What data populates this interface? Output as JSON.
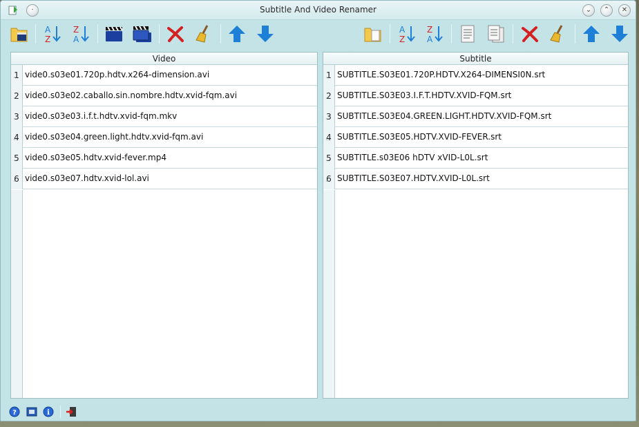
{
  "window": {
    "title": "Subtitle And Video Renamer",
    "buttons": {
      "minimize": "⌄",
      "maximize": "⌃",
      "close": "✕"
    }
  },
  "toolbar_left": [
    {
      "name": "open-videos",
      "icon": "folder-video-icon"
    },
    {
      "name": "sort-asc",
      "icon": "sort-az-icon"
    },
    {
      "name": "sort-desc",
      "icon": "sort-za-icon"
    },
    {
      "name": "video-clapper",
      "icon": "clapper-icon"
    },
    {
      "name": "video-clapper-multi",
      "icon": "clapper-multi-icon"
    },
    {
      "name": "remove",
      "icon": "red-x-icon"
    },
    {
      "name": "clear",
      "icon": "broom-icon"
    },
    {
      "name": "move-up",
      "icon": "arrow-up-icon"
    },
    {
      "name": "move-down",
      "icon": "arrow-down-icon"
    }
  ],
  "toolbar_right": [
    {
      "name": "open-subtitles",
      "icon": "folder-document-icon"
    },
    {
      "name": "sort-asc",
      "icon": "sort-az-icon"
    },
    {
      "name": "sort-desc",
      "icon": "sort-za-icon"
    },
    {
      "name": "document",
      "icon": "document-icon"
    },
    {
      "name": "documents",
      "icon": "documents-icon"
    },
    {
      "name": "remove",
      "icon": "red-x-icon"
    },
    {
      "name": "clear",
      "icon": "broom-icon"
    },
    {
      "name": "move-up",
      "icon": "arrow-up-icon"
    },
    {
      "name": "move-down",
      "icon": "arrow-down-icon"
    }
  ],
  "video_panel": {
    "header": "Video",
    "rows": [
      {
        "num": "1",
        "name": "vide0.s03e01.720p.hdtv.x264-dimension.avi"
      },
      {
        "num": "2",
        "name": "vide0.s03e02.caballo.sin.nombre.hdtv.xvid-fqm.avi"
      },
      {
        "num": "3",
        "name": "vide0.s03e03.i.f.t.hdtv.xvid-fqm.mkv"
      },
      {
        "num": "4",
        "name": "vide0.s03e04.green.light.hdtv.xvid-fqm.avi"
      },
      {
        "num": "5",
        "name": "vide0.s03e05.hdtv.xvid-fever.mp4"
      },
      {
        "num": "6",
        "name": "vide0.s03e07.hdtv.xvid-lol.avi"
      }
    ]
  },
  "subtitle_panel": {
    "header": "Subtitle",
    "rows": [
      {
        "num": "1",
        "name": "SUBTITLE.S03E01.720P.HDTV.X264-DIMENSI0N.srt"
      },
      {
        "num": "2",
        "name": "SUBTITLE.S03E03.I.F.T.HDTV.XVID-FQM.srt"
      },
      {
        "num": "3",
        "name": "SUBTITLE.S03E04.GREEN.LIGHT.HDTV.XVID-FQM.srt"
      },
      {
        "num": "4",
        "name": "SUBTITLE.S03E05.HDTV.XVID-FEVER.srt"
      },
      {
        "num": "5",
        "name": "SUBTITLE.s03E06 hDTV xVID-L0L.srt"
      },
      {
        "num": "6",
        "name": "SUBTITLE.S03E07.HDTV.XVID-L0L.srt"
      }
    ]
  },
  "statusbar": [
    {
      "name": "help",
      "icon": "help-icon"
    },
    {
      "name": "about-qt",
      "icon": "qt-icon"
    },
    {
      "name": "info",
      "icon": "info-icon"
    },
    {
      "name": "exit",
      "icon": "exit-icon"
    }
  ],
  "colors": {
    "window_bg": "#c3e3e7",
    "arrow_blue": "#1e7fd6",
    "remove_red": "#d42020",
    "folder_yellow": "#f2c94c"
  }
}
